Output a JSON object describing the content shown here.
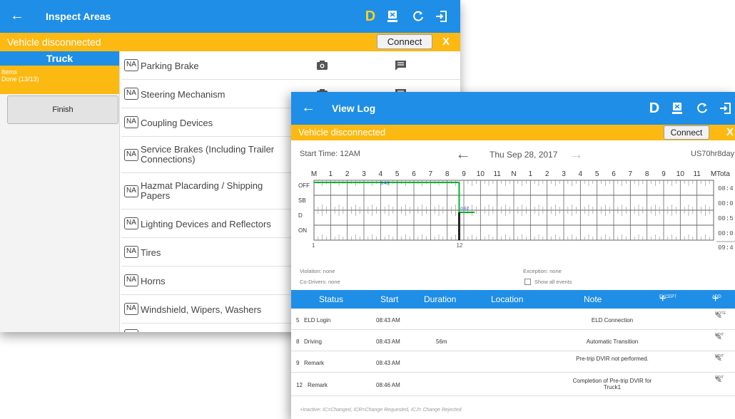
{
  "inspect": {
    "title": "Inspect Areas",
    "duty_letter": "D",
    "disconnected_text": "Vehicle disconnected",
    "connect_label": "Connect",
    "dismiss_label": "X",
    "section": "Truck",
    "items_label": "Items",
    "items_progress": "Done (13/13)",
    "finish_label": "Finish",
    "na_badge": "NA",
    "items": [
      {
        "label": "Parking Brake"
      },
      {
        "label": "Steering Mechanism"
      },
      {
        "label": "Coupling Devices"
      },
      {
        "label": "Service Brakes (Including Trailer Connections)"
      },
      {
        "label": "Hazmat Placarding / Shipping Papers"
      },
      {
        "label": "Lighting Devices and Reflectors"
      },
      {
        "label": "Tires"
      },
      {
        "label": "Horns"
      },
      {
        "label": "Windshield, Wipers, Washers"
      }
    ]
  },
  "viewlog": {
    "title": "View Log",
    "duty_letter": "D",
    "disconnected_text": "Vehicle disconnected",
    "connect_label": "Connect",
    "dismiss_label": "X",
    "start_time": "Start Time: 12AM",
    "date": "Thu Sep 28, 2017",
    "cycle": "US70hr8day",
    "violation": "Violation: none",
    "codrivers": "Co-Drivers: none",
    "exception": "Exception: none",
    "show_all_events": "Show all events",
    "footnote": "+Inactive: IC=Changed, ICR=Change Requested, ICJ= Change Rejected",
    "graph": {
      "hour_labels": [
        "M",
        "1",
        "2",
        "3",
        "4",
        "5",
        "6",
        "7",
        "8",
        "9",
        "10",
        "11",
        "N",
        "1",
        "2",
        "3",
        "4",
        "5",
        "6",
        "7",
        "8",
        "9",
        "10",
        "11",
        "M"
      ],
      "rows": [
        "OFF",
        "SB",
        "D",
        "ON"
      ],
      "total_header": "Tota",
      "totals": [
        "08:4",
        "00:0",
        "00:5",
        "00:0"
      ],
      "grand_total": "09:4",
      "off_duration": "8:43",
      "drive_duration": "0:57",
      "below_left": "1",
      "below_mid": "12",
      "segments": [
        {
          "status": "OFF",
          "from_hour": 0.0,
          "to_hour": 8.72
        },
        {
          "status": "D",
          "from_hour": 8.72,
          "to_hour": 9.65
        }
      ]
    },
    "table": {
      "headers": {
        "status": "Status",
        "start": "Start",
        "duration": "Duration",
        "location": "Location",
        "note": "Note",
        "except": "EXCEPT",
        "add": "ADD"
      },
      "rows": [
        {
          "num": "5",
          "status": "ELD Login",
          "start": "08:43 AM",
          "duration": "",
          "note": "ELD Connection",
          "action": "NOTE"
        },
        {
          "num": "8",
          "status": "Driving",
          "start": "08:43 AM",
          "duration": "56m",
          "note": "Automatic Transition",
          "action": "EDIT"
        },
        {
          "num": "9",
          "status": "Remark",
          "start": "08:43 AM",
          "duration": "",
          "note": "Pre-trip DVIR not performed.",
          "action": "EDIT"
        },
        {
          "num": "12",
          "status": "Remark",
          "start": "08:46 AM",
          "duration": "",
          "note": "Completion of Pre-trip DVIR for Truck1",
          "action": "EDIT"
        }
      ]
    }
  },
  "colors": {
    "app_blue": "#1f8ee6",
    "warning_yellow": "#fcb912",
    "graph_off_green": "#00b32c",
    "graph_drive_green": "#00b32c"
  },
  "icons": [
    "back-arrow-icon",
    "device-icon",
    "refresh-icon",
    "logout-icon",
    "camera-icon",
    "note-icon",
    "pencil-icon",
    "plus-icon"
  ]
}
